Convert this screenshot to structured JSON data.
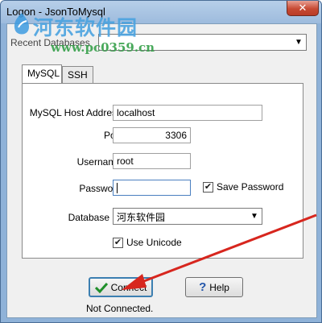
{
  "window": {
    "title": "Logon - JsonToMysql",
    "close_glyph": "✕"
  },
  "watermark": {
    "site_name": "河东软件园",
    "url": "www.pc0359.cn"
  },
  "recent": {
    "label": "Recent Databases",
    "value": ""
  },
  "tabs": [
    {
      "label": "MySQL",
      "active": true
    },
    {
      "label": "SSH",
      "active": false
    }
  ],
  "form": {
    "host_label": "MySQL Host Address",
    "host_value": "localhost",
    "port_label": "Port",
    "port_value": "3306",
    "username_label": "Username",
    "username_value": "root",
    "password_label": "Password",
    "password_value": "",
    "save_password_label": "Save Password",
    "save_password_checked": true,
    "database_label": "Database",
    "database_value": "河东软件园",
    "use_unicode_label": "Use Unicode",
    "use_unicode_checked": true
  },
  "buttons": {
    "connect_label": "Connect",
    "help_label": "Help"
  },
  "status": {
    "text": "Not Connected."
  },
  "colors": {
    "annotation_arrow": "#d7261e",
    "check_green": "#1f8f2a",
    "help_blue": "#2255aa"
  }
}
